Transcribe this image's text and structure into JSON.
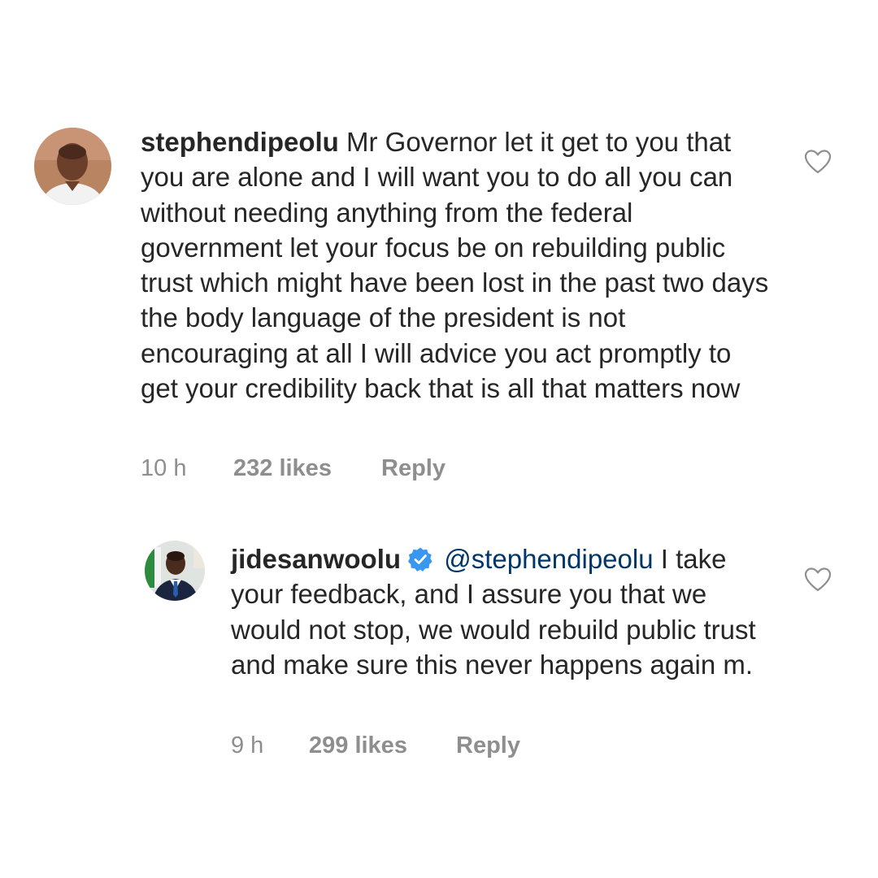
{
  "comments": [
    {
      "username": "stephendipeolu",
      "text": "Mr Governor let it get to you that you are alone and I will want you to do all you can without needing anything from the federal government let your focus be on rebuilding public trust which might have been lost in the past two days the body language of the president is not encouraging at all I will advice you act promptly to get your credibility back that is all that matters now",
      "time": "10 h",
      "likes": "232 likes",
      "reply_label": "Reply",
      "verified": false,
      "avatar_icon": "profile-photo-man"
    },
    {
      "username": "jidesanwoolu",
      "mention": "@stephendipeolu",
      "text": "I take your feedback, and I assure you that we would not stop, we would rebuild public trust and make sure this never happens again m.",
      "time": "9 h",
      "likes": "299 likes",
      "reply_label": "Reply",
      "verified": true,
      "avatar_icon": "profile-photo-man-suit"
    }
  ],
  "icons": {
    "like": "heart-outline-icon",
    "verified": "verified-badge-icon"
  },
  "colors": {
    "text": "#262626",
    "muted": "#8e8e8e",
    "mention": "#00376b",
    "verified": "#3897f0"
  }
}
